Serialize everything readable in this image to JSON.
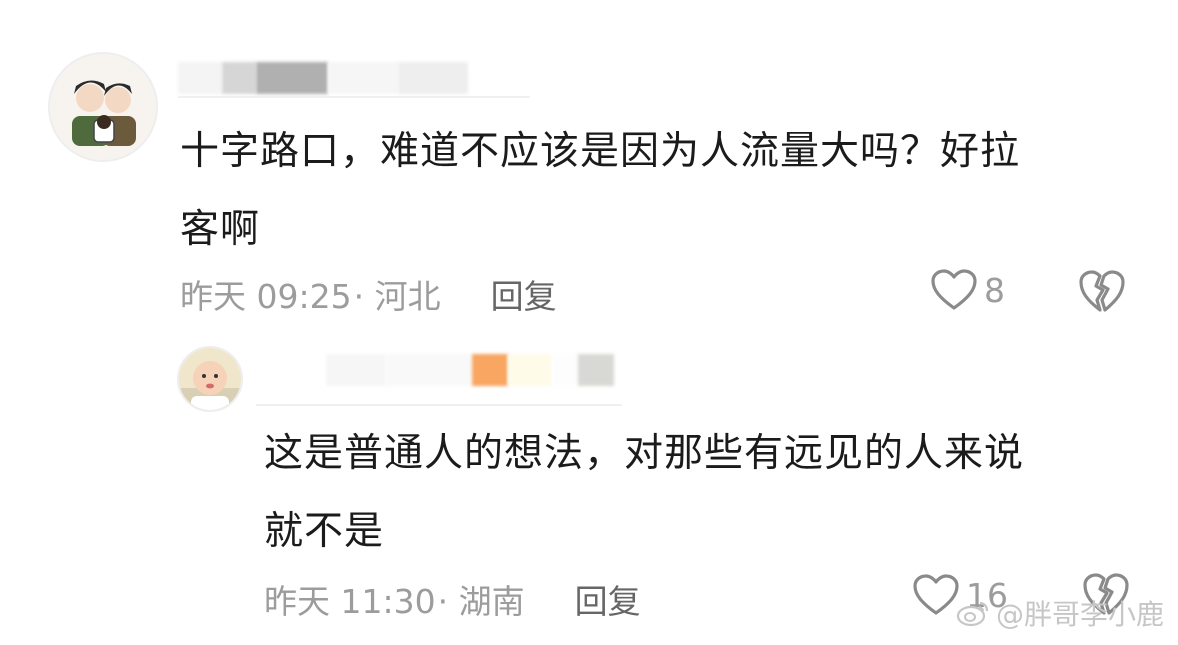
{
  "comments": [
    {
      "text_line1": "十字路口，难道不应该是因为人流量大吗？好拉",
      "text_line2": "客啊",
      "date": "昨天 09:25",
      "location": "· 河北",
      "reply_label": "回复",
      "like_count": "8",
      "icons": {
        "like": "heart-outline-icon",
        "dislike": "broken-heart-icon"
      }
    },
    {
      "text_line1": "这是普通人的想法，对那些有远见的人来说",
      "text_line2": "就不是",
      "date": "昨天 11:30",
      "location": "· 湖南",
      "reply_label": "回复",
      "like_count": "16",
      "icons": {
        "like": "heart-outline-icon",
        "dislike": "broken-heart-icon"
      }
    }
  ],
  "watermark": {
    "text": "@胖哥李小鹿",
    "icon": "weibo-icon"
  },
  "colors": {
    "text": "#1b1b1b",
    "meta": "#9c9c9c",
    "reply": "#666666",
    "icon": "#8a8a8a"
  }
}
